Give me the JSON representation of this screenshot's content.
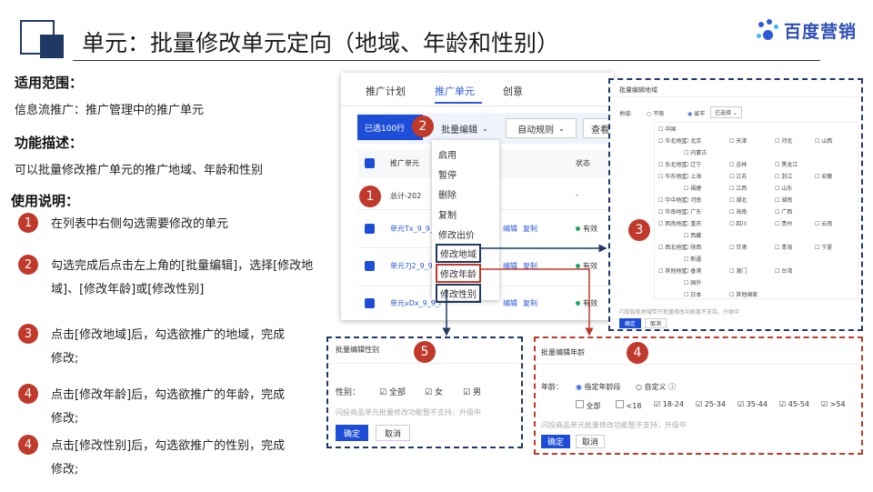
{
  "title": "单元：批量修改单元定向（地域、年龄和性别）",
  "brand": "百度营销",
  "sections": {
    "scope_heading": "适用范围：",
    "scope_text": "信息流推广：推广管理中的推广单元",
    "func_heading": "功能描述：",
    "func_text": "可以批量修改推广单元的推广地域、年龄和性别",
    "usage_heading": "使用说明：",
    "steps": [
      {
        "num": "1",
        "line1": "在列表中右侧勾选需要修改的单元",
        "line2": ""
      },
      {
        "num": "2",
        "line1": "勾选完成后点击左上角的[批量编辑]，选择[修改地",
        "line2": "域]、[修改年龄]或[修改性别]"
      },
      {
        "num": "3",
        "line1": "点击[修改地域]后，勾选欲推广的地域，完成",
        "line2": "修改;"
      },
      {
        "num": "4",
        "line1": "点击[修改年龄]后，勾选欲推广的年龄，完成",
        "line2": "修改;"
      },
      {
        "num": "4",
        "line1": "点击[修改性别]后，勾选欲推广的性别，完成",
        "line2": "修改;"
      }
    ]
  },
  "list_panel": {
    "tabs": [
      "推广计划",
      "推广单元",
      "创意"
    ],
    "selected": "已选100行",
    "batch_edit": "批量编辑",
    "auto_rule": "自动规则",
    "view": "查看",
    "col_unit": "推广单元",
    "col_status": "状态",
    "total": "总计-202",
    "total_status": "-",
    "rows": [
      {
        "name": "单元Tx_9_9_",
        "edit": "编辑",
        "copy": "复制",
        "status": "有效"
      },
      {
        "name": "单元7J2_9_9",
        "edit": "编辑",
        "copy": "复制",
        "status": "有效"
      },
      {
        "name": "单元vDx_9_9_r",
        "edit": "编辑",
        "copy": "复制",
        "status": "有效"
      }
    ],
    "menu": [
      "启用",
      "暂停",
      "删除",
      "复制",
      "修改出价",
      "修改地域",
      "修改年龄",
      "修改性别"
    ],
    "callout1": "1",
    "callout2": "2"
  },
  "region_panel": {
    "title": "批量编辑地域",
    "label": "地域:",
    "opt_unlimited": "不限",
    "opt_province": "省市",
    "selected_tag": "已选择",
    "rows": [
      {
        "region": "中国",
        "items": []
      },
      {
        "region": "华北地区",
        "items": [
          "北京",
          "天津",
          "河北",
          "山西"
        ]
      },
      {
        "region": "",
        "items": [
          "内蒙古"
        ]
      },
      {
        "region": "东北地区",
        "items": [
          "辽宁",
          "吉林",
          "黑龙江"
        ]
      },
      {
        "region": "华东地区",
        "items": [
          "上海",
          "江苏",
          "浙江",
          "安徽"
        ]
      },
      {
        "region": "",
        "items": [
          "福建",
          "江西",
          "山东"
        ]
      },
      {
        "region": "华中地区",
        "items": [
          "河南",
          "湖北",
          "湖南"
        ]
      },
      {
        "region": "华南地区",
        "items": [
          "广东",
          "海南",
          "广西"
        ]
      },
      {
        "region": "西南地区",
        "items": [
          "重庆",
          "四川",
          "贵州",
          "云南"
        ]
      },
      {
        "region": "",
        "items": [
          "西藏"
        ]
      },
      {
        "region": "西北地区",
        "items": [
          "陕西",
          "甘肃",
          "青海",
          "宁夏"
        ]
      },
      {
        "region": "",
        "items": [
          "新疆"
        ]
      },
      {
        "region": "其他地区",
        "items": [
          "香港",
          "澳门",
          "台湾"
        ]
      },
      {
        "region": "",
        "items": [
          "国外"
        ]
      },
      {
        "region": "",
        "items": [
          "日本",
          "其他国家"
        ]
      }
    ],
    "note": "闪投智能地域带只批量修改功能暂不支持，升级中",
    "confirm": "确定",
    "cancel": "取消",
    "callout": "3"
  },
  "gender_panel": {
    "title": "批量编辑性别",
    "label": "性别：",
    "options": [
      "全部",
      "女",
      "男"
    ],
    "note": "闪投商品单元批量修改功能暂不支持，升级中",
    "confirm": "确定",
    "cancel": "取消",
    "callout": "5"
  },
  "age_panel": {
    "title": "批量编辑年龄",
    "label": "年龄：",
    "opt_specified": "指定年龄段",
    "opt_custom": "自定义",
    "ages": [
      "全部",
      "<18",
      "18-24",
      "25-34",
      "35-44",
      "45-54",
      ">54"
    ],
    "note": "闪投商品单元批量修改功能暂不支持，升级中",
    "confirm": "确定",
    "cancel": "取消",
    "callout": "4"
  },
  "colors": {
    "navy": "#1f3864",
    "accent": "#c0392b",
    "blue": "#1e4ed8"
  }
}
